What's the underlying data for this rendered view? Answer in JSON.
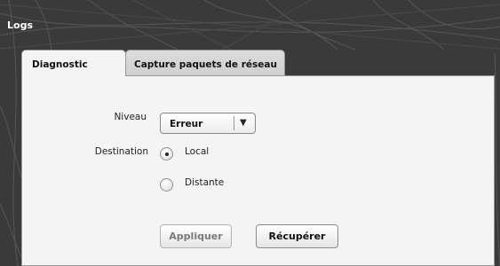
{
  "window": {
    "title": "Logs"
  },
  "tabs": [
    {
      "label": "Diagnostic",
      "active": true
    },
    {
      "label": "Capture paquets de réseau",
      "active": false
    }
  ],
  "form": {
    "level_label": "Niveau",
    "level_value": "Erreur",
    "destination_label": "Destination",
    "destination_options": [
      {
        "label": "Local",
        "selected": true
      },
      {
        "label": "Distante",
        "selected": false
      }
    ]
  },
  "buttons": {
    "apply_label": "Appliquer",
    "apply_enabled": false,
    "retrieve_label": "Récupérer",
    "retrieve_enabled": true
  },
  "icons": {
    "dropdown": "chevron-down-icon"
  }
}
